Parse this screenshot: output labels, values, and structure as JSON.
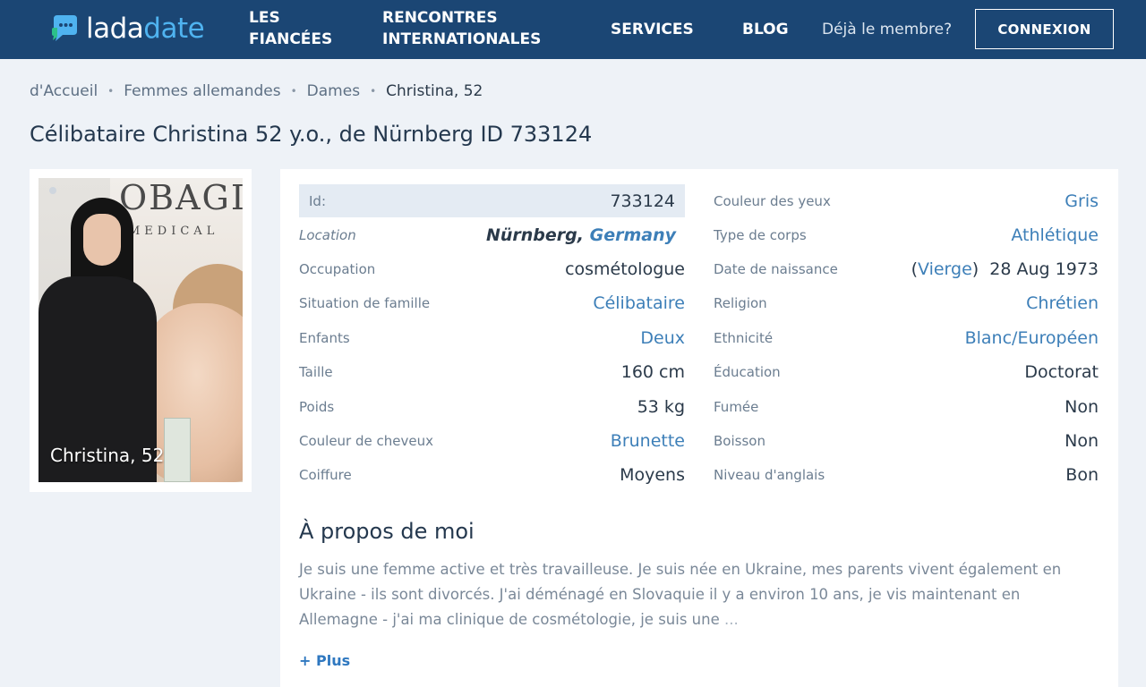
{
  "header": {
    "logo_part1": "lada",
    "logo_part2": "date",
    "nav": [
      {
        "line1": "LES",
        "line2": "FIANCÉES"
      },
      {
        "line1": "RENCONTRES",
        "line2": "INTERNATIONALES"
      },
      {
        "label": "SERVICES"
      },
      {
        "label": "BLOG"
      }
    ],
    "member_text": "Déjà le membre?",
    "login_label": "CONNEXION",
    "colors": {
      "bar": "#1b4674",
      "accent": "#4fb3f0"
    }
  },
  "breadcrumb": [
    "d'Accueil",
    "Femmes allemandes",
    "Dames",
    "Christina, 52"
  ],
  "title": "Célibataire Christina 52 y.o., de Nürnberg ID 733124",
  "photo": {
    "caption": "Christina, 52",
    "brand": "OBAGI",
    "brand_sub": "MEDICAL"
  },
  "details_left": {
    "id": {
      "label": "Id:",
      "value": "733124"
    },
    "location": {
      "label": "Location",
      "city": "Nürnberg,",
      "country": "Germany"
    },
    "occupation": {
      "label": "Occupation",
      "value": "cosmétologue"
    },
    "marital": {
      "label": "Situation de famille",
      "value": "Célibataire"
    },
    "children": {
      "label": "Enfants",
      "value": "Deux"
    },
    "height": {
      "label": "Taille",
      "value": "160 cm"
    },
    "weight": {
      "label": "Poids",
      "value": "53 kg"
    },
    "hair_color": {
      "label": "Couleur de cheveux",
      "value": "Brunette"
    },
    "hairstyle": {
      "label": "Coiffure",
      "value": "Moyens"
    }
  },
  "details_right": {
    "eyes": {
      "label": "Couleur des yeux",
      "value": "Gris"
    },
    "body": {
      "label": "Type de corps",
      "value": "Athlétique"
    },
    "birth": {
      "label": "Date de naissance",
      "paren_open": "(",
      "sign": "Vierge",
      "paren_close": ")",
      "date": "28 Aug 1973"
    },
    "religion": {
      "label": "Religion",
      "value": "Chrétien"
    },
    "ethnicity": {
      "label": "Ethnicité",
      "value": "Blanc/Européen"
    },
    "education": {
      "label": "Éducation",
      "value": "Doctorat"
    },
    "smoke": {
      "label": "Fumée",
      "value": "Non"
    },
    "drink": {
      "label": "Boisson",
      "value": "Non"
    },
    "english": {
      "label": "Niveau d'anglais",
      "value": "Bon"
    }
  },
  "about": {
    "title": "À propos de moi",
    "text": "Je suis une femme active et très travailleuse. Je suis née en Ukraine, mes parents vivent également en Ukraine - ils sont divorcés. J'ai déménagé en Slovaquie il y a environ 10 ans, je vis maintenant en Allemagne - j'ai ma clinique de cosmétologie, je suis une",
    "ellipsis": "...",
    "more_label": "+ Plus"
  }
}
